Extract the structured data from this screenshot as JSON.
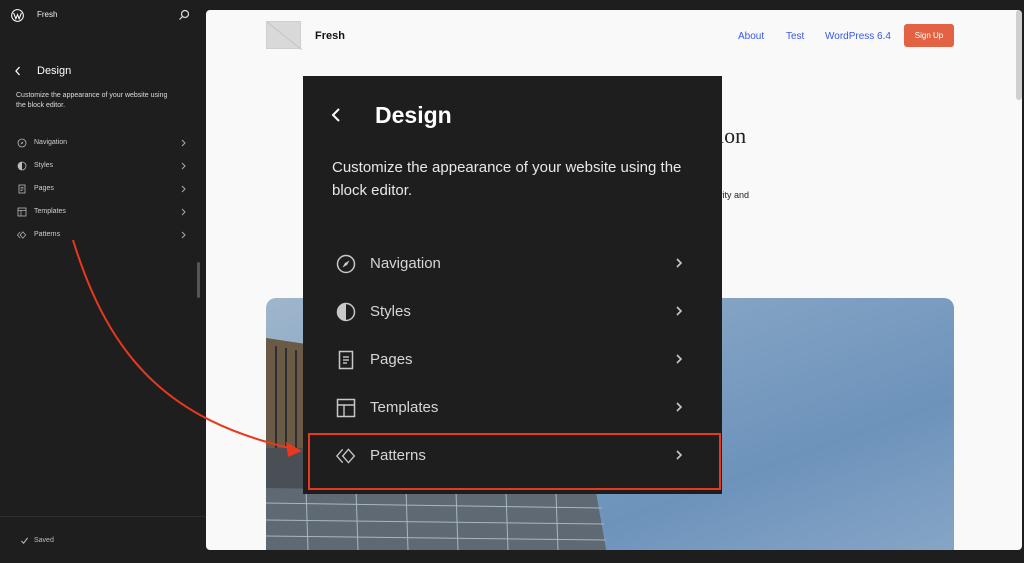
{
  "sidebar": {
    "site_name": "Fresh",
    "title": "Design",
    "description": "Customize the appearance of your website using the block editor.",
    "items": [
      {
        "label": "Navigation",
        "icon": "compass-icon"
      },
      {
        "label": "Styles",
        "icon": "half-circle-icon"
      },
      {
        "label": "Pages",
        "icon": "page-icon"
      },
      {
        "label": "Templates",
        "icon": "layout-icon"
      },
      {
        "label": "Patterns",
        "icon": "diamonds-icon"
      }
    ],
    "status": "Saved"
  },
  "canvas": {
    "site_name": "Fresh",
    "nav": [
      "About",
      "Test",
      "WordPress 6.4"
    ],
    "signup": "Sign Up",
    "heading_fragment": "ion",
    "body_fragment": "vity and"
  },
  "colors": {
    "accent_link": "#3858e9",
    "signup": "#e26243",
    "callout": "#e8381e"
  }
}
